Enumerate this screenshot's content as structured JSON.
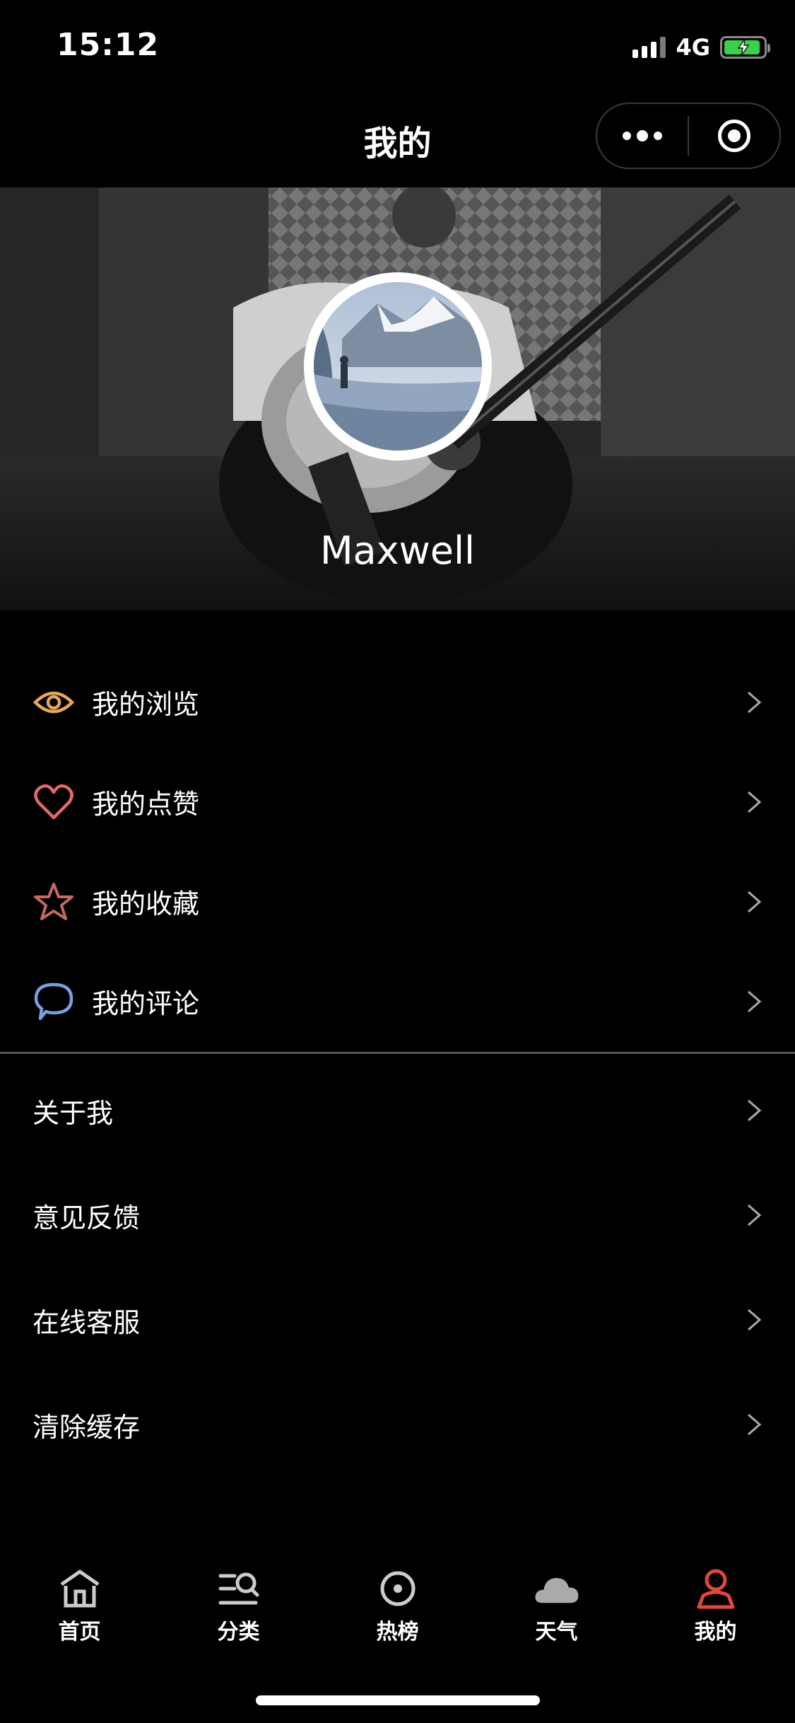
{
  "status_bar": {
    "time": "15:12",
    "network": "4G"
  },
  "nav": {
    "title": "我的"
  },
  "profile": {
    "name": "Maxwell"
  },
  "menu_primary": [
    {
      "label": "我的浏览",
      "icon": "eye-icon",
      "color": "#e6a85a"
    },
    {
      "label": "我的点赞",
      "icon": "heart-icon",
      "color": "#e06a6a"
    },
    {
      "label": "我的收藏",
      "icon": "star-icon",
      "color": "#c46a64"
    },
    {
      "label": "我的评论",
      "icon": "comment-icon",
      "color": "#7a9fe0"
    }
  ],
  "menu_secondary": [
    {
      "label": "关于我"
    },
    {
      "label": "意见反馈"
    },
    {
      "label": "在线客服"
    },
    {
      "label": "清除缓存"
    }
  ],
  "tabs": [
    {
      "label": "首页",
      "icon": "home-icon"
    },
    {
      "label": "分类",
      "icon": "category-search-icon"
    },
    {
      "label": "热榜",
      "icon": "target-icon"
    },
    {
      "label": "天气",
      "icon": "cloud-icon"
    },
    {
      "label": "我的",
      "icon": "user-icon",
      "active": true,
      "active_color": "#e0483c"
    }
  ]
}
